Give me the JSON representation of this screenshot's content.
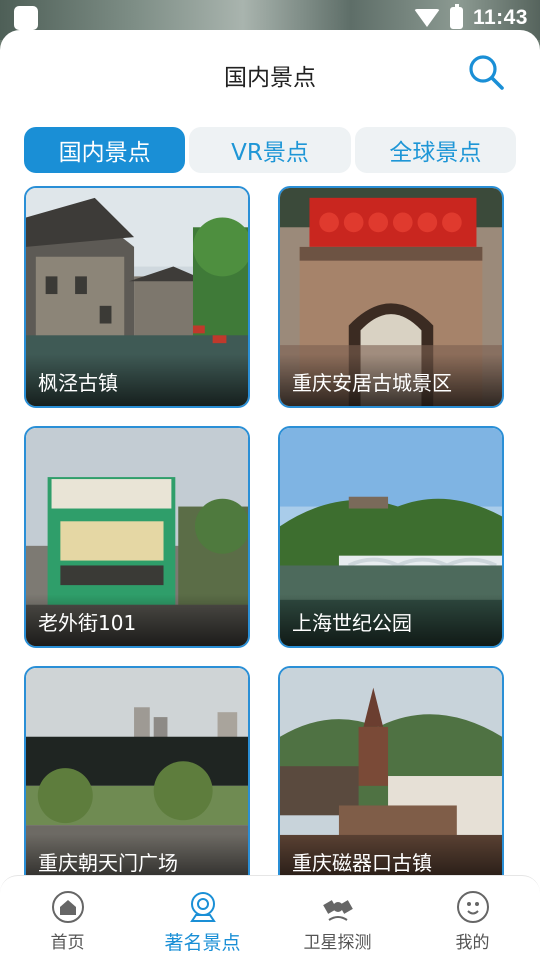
{
  "status": {
    "time": "11:43"
  },
  "header": {
    "title": "国内景点"
  },
  "tabs": [
    {
      "label": "国内景点",
      "active": true
    },
    {
      "label": "VR景点",
      "active": false
    },
    {
      "label": "全球景点",
      "active": false
    }
  ],
  "cards": [
    {
      "name": "枫泾古镇"
    },
    {
      "name": "重庆安居古城景区"
    },
    {
      "name": "老外街101"
    },
    {
      "name": "上海世纪公园"
    },
    {
      "name": "重庆朝天门广场"
    },
    {
      "name": "重庆磁器口古镇"
    }
  ],
  "bottom_nav": [
    {
      "label": "首页",
      "icon": "home-icon"
    },
    {
      "label": "著名景点",
      "icon": "camera-icon",
      "active": true
    },
    {
      "label": "卫星探测",
      "icon": "satellite-icon"
    },
    {
      "label": "我的",
      "icon": "profile-icon"
    }
  ],
  "colors": {
    "accent": "#1a8fd6",
    "tab_inactive_bg": "#eef2f4"
  }
}
